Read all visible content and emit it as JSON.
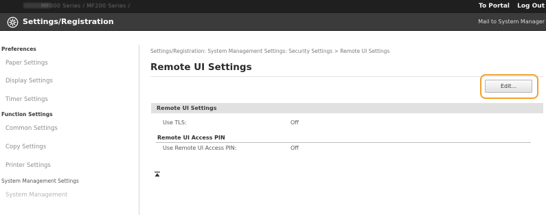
{
  "topbar": {
    "model": "MF000 Series / MF200 Series /",
    "to_portal": "To Portal",
    "log_out": "Log Out"
  },
  "header": {
    "title": "Settings/Registration",
    "mail_link": "Mail to System Manager",
    "icon": "settings-gear-icon"
  },
  "sidebar": {
    "preferences": "Preferences",
    "paper_settings": "Paper Settings",
    "display_settings": "Display Settings",
    "timer_settings": "Timer Settings",
    "function_settings": "Function Settings",
    "common_settings": "Common Settings",
    "copy_settings": "Copy Settings",
    "printer_settings": "Printer Settings",
    "system_management_settings": "System Management Settings",
    "system_management": "System Management"
  },
  "main": {
    "breadcrumb": "Settings/Registration: System Management Settings: Security Settings > Remote UI Settings",
    "title": "Remote UI Settings",
    "edit_label": "Edit...",
    "section_label": "Remote UI Settings",
    "use_tls_label": "Use TLS:",
    "use_tls_value": "Off",
    "access_pin_heading": "Remote UI Access PIN",
    "use_pin_label": "Use Remote UI Access PIN:",
    "use_pin_value": "Off",
    "top_icon": "to-top-arrow-icon",
    "highlight_color": "#f0a02a"
  }
}
